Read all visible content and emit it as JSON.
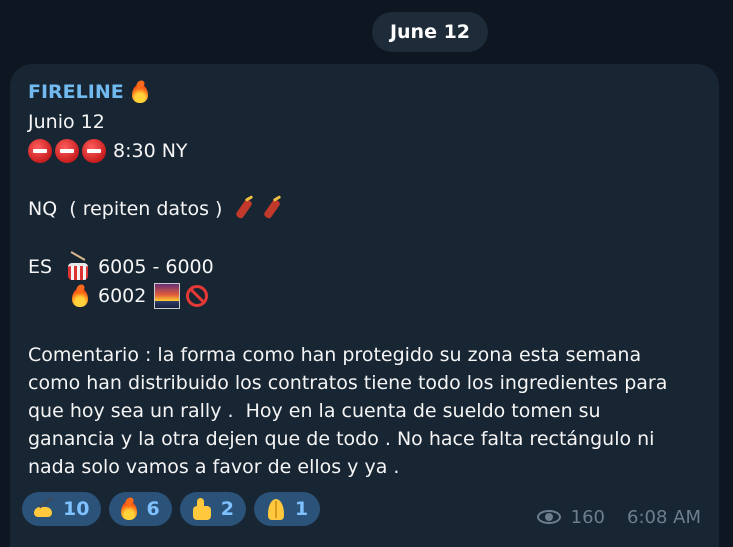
{
  "date_divider": "June 12",
  "message": {
    "sender": "FIRELINE",
    "lines": {
      "l1": "Junio 12",
      "l2": "8:30 NY",
      "l3": "NQ  ( repiten datos )",
      "l4_prefix": "ES",
      "l4_range": "6005 - 6000",
      "l5_value": "6002",
      "c1": "Comentario : la forma como han protegido su zona esta semana",
      "c2": "como han distribuido los contratos tiene todo los ingredientes para",
      "c3": "que hoy sea un rally .  Hoy en la cuenta de sueldo tomen su",
      "c4": "ganancia y la otra dejen que de todo . No hace falta rectángulo ni",
      "c5": "nada solo vamos a favor de ellos y ya ."
    },
    "reactions": [
      {
        "icon": "writing-hand-icon",
        "count": "10"
      },
      {
        "icon": "fire-icon",
        "count": "6"
      },
      {
        "icon": "thumbs-up-icon",
        "count": "2"
      },
      {
        "icon": "folded-hands-icon",
        "count": "1"
      }
    ],
    "views": "160",
    "time": "6:08 AM"
  },
  "colors": {
    "background": "#0e1621",
    "bubble": "#182533",
    "sender": "#71baf0",
    "reaction_bg": "#2b5278",
    "reaction_text": "#7fc1ff",
    "meta_text": "#6d7f8f"
  }
}
